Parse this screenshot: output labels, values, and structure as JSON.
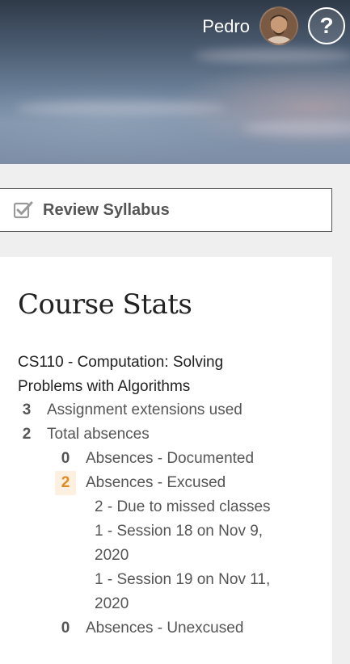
{
  "header": {
    "user_name": "Pedro",
    "help_label": "?"
  },
  "actions": {
    "review_syllabus": "Review Syllabus"
  },
  "stats": {
    "title": "Course Stats",
    "course": "CS110 - Computation: Solving Problems with Algorithms",
    "items": [
      {
        "count": "3",
        "label": "Assignment extensions used"
      },
      {
        "count": "2",
        "label": "Total absences"
      }
    ],
    "absences": {
      "documented": {
        "count": "0",
        "label": "Absences - Documented"
      },
      "excused": {
        "count": "2",
        "label": "Absences - Excused"
      },
      "excused_details": [
        "2 - Due to missed classes",
        "1 - Session 18 on Nov 9,",
        "2020",
        "1 - Session 19 on Nov 11,",
        "2020"
      ],
      "unexcused": {
        "count": "0",
        "label": "Absences - Unexcused"
      }
    }
  },
  "colors": {
    "highlight": "#e08a20",
    "highlight_bg": "#fdf0e0",
    "card_bg": "#ffffff",
    "page_bg": "#efefef"
  },
  "icons": [
    "checkbox-check-icon",
    "avatar",
    "help-icon"
  ]
}
